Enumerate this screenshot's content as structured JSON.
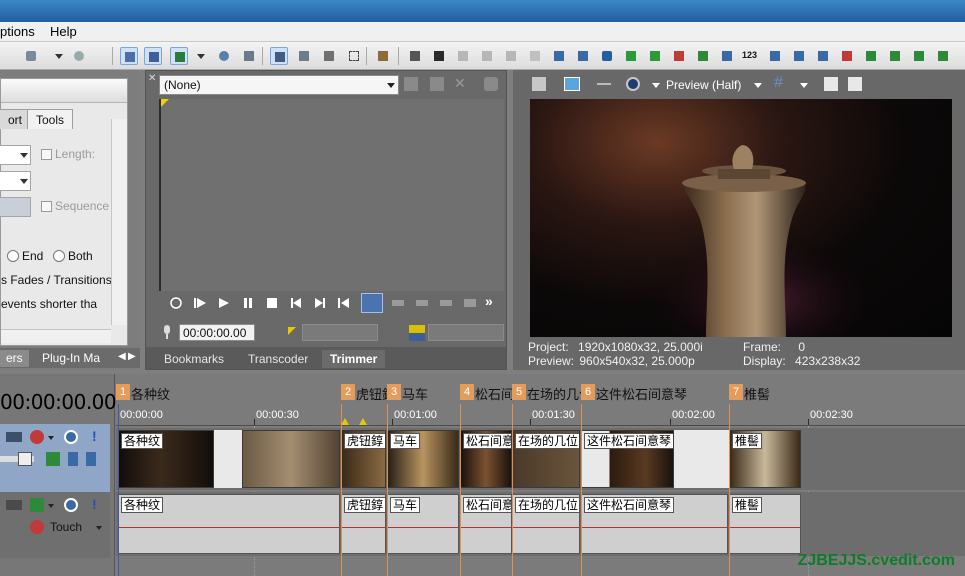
{
  "menu": {
    "options": "ptions",
    "help": "Help"
  },
  "toolbar": {
    "badge_123": "123"
  },
  "left_panel": {
    "tabs": [
      "ort",
      "Tools"
    ],
    "length_label": "Length:",
    "sequence_label": "Sequence",
    "radio_end": "End",
    "radio_both": "Both",
    "fades_label": "s Fades / Transitions",
    "events_label": "events shorter tha",
    "bottom_tabs": [
      "ers",
      "Plug-In Ma"
    ]
  },
  "trimmer": {
    "source": "(None)",
    "timecode_1": "00:00:00.00",
    "tabs": [
      "Bookmarks",
      "Transcoder",
      "Trimmer"
    ]
  },
  "preview": {
    "mode": "Preview (Half)",
    "project_label": "Project:",
    "project_value": "1920x1080x32, 25.000i",
    "preview_label": "Preview:",
    "preview_value": "960x540x32, 25.000p",
    "frame_label": "Frame:",
    "frame_value": "0",
    "display_label": "Display:",
    "display_value": "423x238x32"
  },
  "timeline": {
    "timecode": "00:00:00.00",
    "touch_label": "Touch",
    "ruler": [
      "00:00:00",
      "00:00:30",
      "00:01:00",
      "00:01:30",
      "00:02:00",
      "00:02:30"
    ],
    "markers": [
      {
        "num": "1",
        "label": "各种纹"
      },
      {
        "num": "2",
        "label": "虎钮錞"
      },
      {
        "num": "3",
        "label": "马车"
      },
      {
        "num": "4",
        "label": "松石间"
      },
      {
        "num": "5",
        "label": "在场的几位"
      },
      {
        "num": "6",
        "label": "这件松石间意琴"
      },
      {
        "num": "7",
        "label": "椎髻"
      }
    ],
    "video_clips": [
      "各种纹",
      "虎钮錞",
      "马车",
      "松石间意",
      "在场的几位",
      "这件松石间意琴",
      "椎髻"
    ],
    "audio_clips": [
      "各种纹",
      "虎钮錞",
      "马车",
      "松石间意",
      "在场的几位",
      "这件松石间意琴",
      "椎髻"
    ]
  },
  "watermark": "ZJBEJJS.cvedit.com"
}
